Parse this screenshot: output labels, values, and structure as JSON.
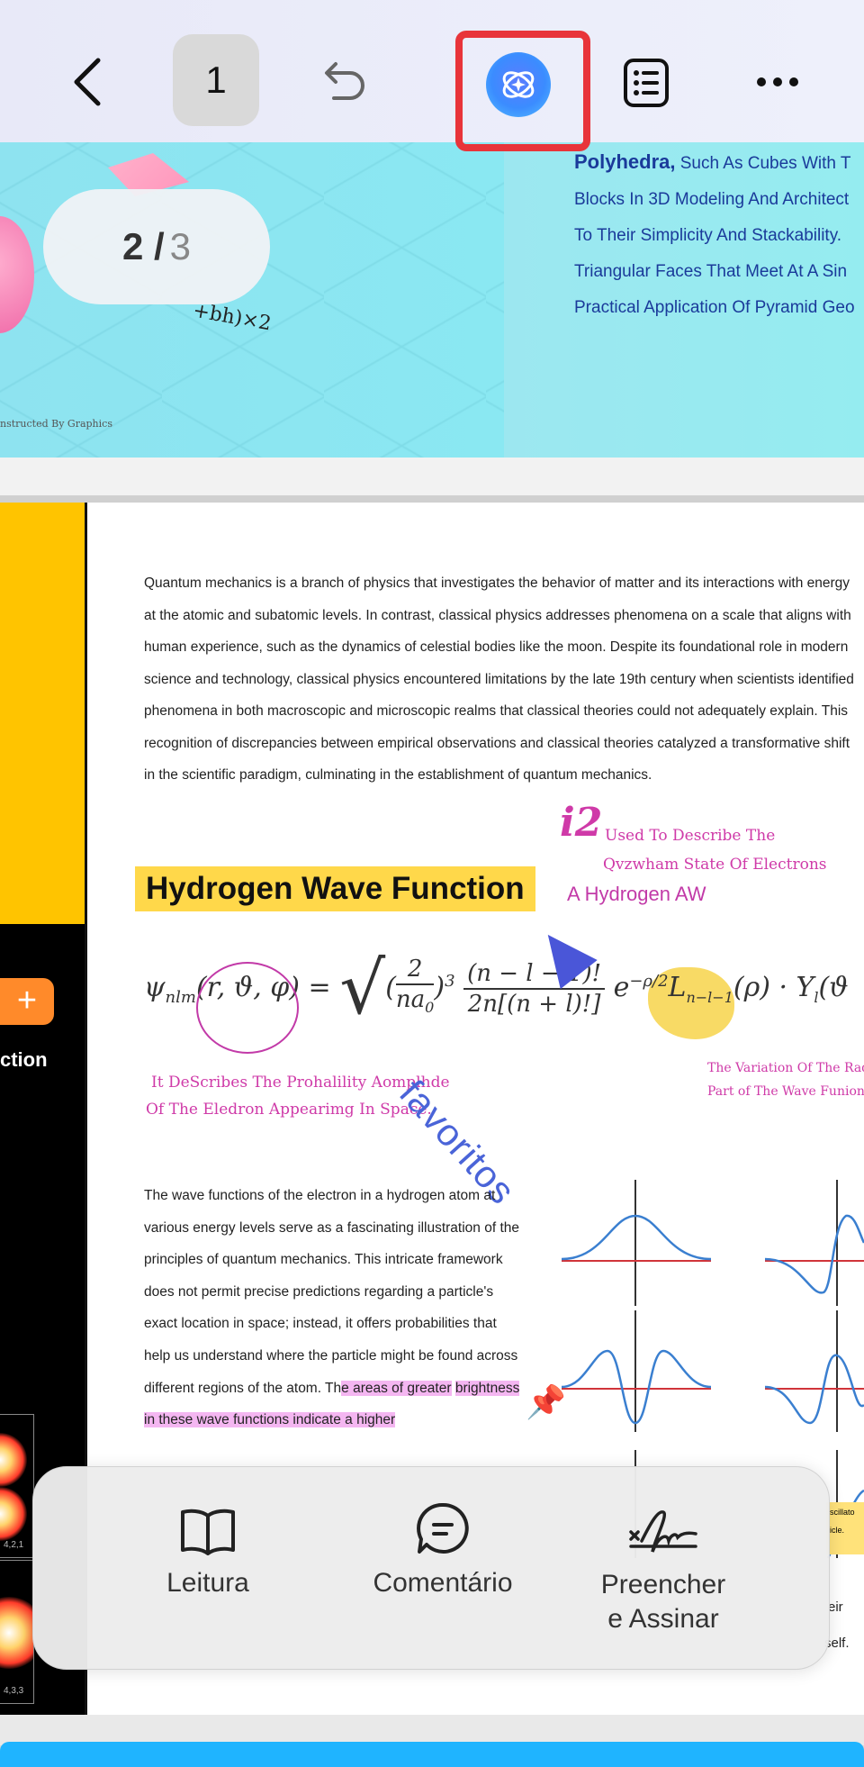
{
  "topbar": {
    "page_number": "1",
    "icons": [
      "back-arrow-icon",
      "undo-icon",
      "ai-assistant-icon",
      "table-of-contents-icon",
      "more-icon"
    ]
  },
  "page_indicator": {
    "current": "2 /",
    "total": "3"
  },
  "page1": {
    "lines": [
      {
        "bold": "Polyhedra,",
        "text": " Such As Cubes With T"
      },
      {
        "bold": "",
        "text": "Blocks In 3D Modeling And Architect"
      },
      {
        "bold": "",
        "text": "To Their Simplicity And Stackability."
      },
      {
        "bold": "",
        "text": "Triangular Faces That Meet At A Sin"
      },
      {
        "bold": "",
        "text": "Practical Application Of Pyramid Geo"
      }
    ],
    "formula_fragment": "+bh)×2",
    "small_caption": "nstructed By Graphics"
  },
  "page2": {
    "left_panel": {
      "plus": "+",
      "label": "ction",
      "thumb1_label": "4,2,1",
      "thumb2_label": "4,3,3"
    },
    "paragraph1": "Quantum mechanics is a branch of physics that investigates the behavior of matter and its interactions with energy at the atomic and subatomic levels. In contrast, classical physics addresses phenomena on a scale that aligns with human experience, such as the dynamics of celestial bodies like the moon. Despite its foundational role in modern science and technology, classical physics encountered limitations by the late 19th century when scientists identified phenomena in both macroscopic and microscopic realms that classical theories could not adequately explain. This recognition of discrepancies between empirical observations and classical theories catalyzed a transformative shift in the scientific paradigm, culminating in the establishment of quantum mechanics.",
    "heading": "Hydrogen Wave Function",
    "annotations": {
      "i2": "i2",
      "a1": "Used To Describe The",
      "a2": "Qvzwham State Of Electrons",
      "a3": "A Hydrogen AW",
      "a4": "It DeScribes The Prohalility Aomplhde",
      "a5": "Of The Eledron Appearimg In Space.",
      "a6": "The Variation Of The Radia",
      "a7": "Part of The Wave Funion.",
      "stamp": "favoritos"
    },
    "paragraph2_plain": "The wave functions of the electron in a hydrogen atom at various energy levels serve as a fascinating illustration of the principles of quantum mechanics. This intricate framework does not permit precise predictions regarding a particle's exact location in space; instead, it offers probabilities that help us understand where the particle might be found across different regions of the atom. Th",
    "paragraph2_highlight1": "e areas of greater",
    "paragraph2_highlight2": "brightness in these wave functions indicate a higher",
    "side_snippets": {
      "s1": "scillato",
      "s2": "icle.",
      "s3": "eir",
      "s4": "self."
    }
  },
  "toolbar": {
    "reading": "Leitura",
    "comment": "Comentário",
    "fill_sign_1": "Preencher",
    "fill_sign_2": "e Assinar"
  }
}
